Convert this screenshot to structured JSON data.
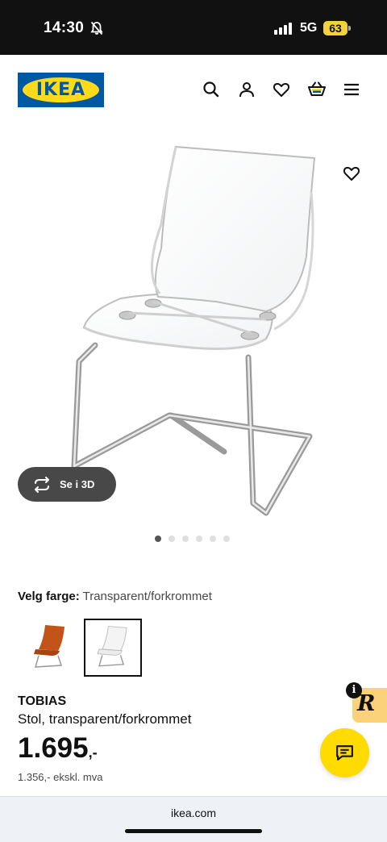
{
  "status_bar": {
    "time": "14:30",
    "network": "5G",
    "battery": "63"
  },
  "header": {
    "logo_text": "IKEA",
    "icons": [
      "search-icon",
      "account-icon",
      "favourites-icon",
      "cart-icon",
      "menu-icon"
    ]
  },
  "product_image": {
    "view_3d_label": "Se i 3D",
    "carousel": {
      "total": 6,
      "active_index": 0
    }
  },
  "color_select": {
    "label": "Velg farge:",
    "value": "Transparent/forkrommet",
    "swatches": [
      {
        "color": "#c2541a",
        "selected": false
      },
      {
        "color": "#e8e8e8",
        "selected": true
      }
    ]
  },
  "product": {
    "name": "TOBIAS",
    "description": "Stol, transparent/forkrommet",
    "price_main": "1.695",
    "price_suffix": ",-",
    "price_ex_vat": "1.356,- ekskl. mva"
  },
  "badges": {
    "info": "i",
    "r_logo": "R"
  },
  "browser": {
    "url": "ikea.com"
  },
  "colors": {
    "ikea_blue": "#0058a3",
    "ikea_yellow": "#ffda1a",
    "chat_yellow": "#ffdb00"
  }
}
